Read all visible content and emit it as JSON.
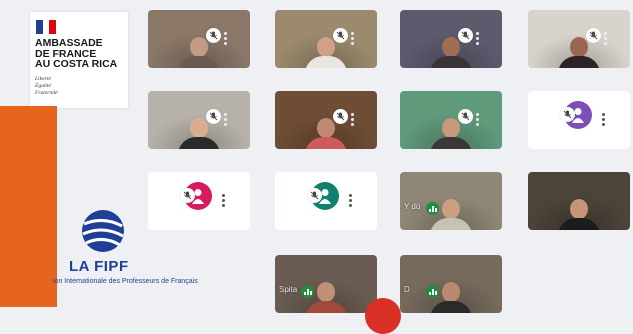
{
  "embassy": {
    "title": "AMBASSADE\nDE FRANCE\nAU COSTA RICA",
    "motto": "Liberté\nÉgalité\nFraternité",
    "flag_colors": [
      "#1f3f96",
      "#ffffff",
      "#e1000f"
    ]
  },
  "fipf": {
    "title": "LA FIPF",
    "subtitle": "ion Internationale des Professeurs de Français",
    "brand_color": "#1f3f96"
  },
  "colors": {
    "accent_orange": "#e6641e",
    "signal_green": "#1e8e3e"
  },
  "participants": [
    {
      "id": "p1",
      "type": "camera",
      "bg": "#8a7768",
      "muted": true,
      "skin": "#c49a82",
      "shirt": "#6a5a50"
    },
    {
      "id": "p2",
      "type": "camera",
      "bg": "#9b8a6d",
      "muted": true,
      "skin": "#d1a08a",
      "shirt": "#e9e6e1"
    },
    {
      "id": "p3",
      "type": "camera",
      "bg": "#5d5a6e",
      "muted": true,
      "skin": "#a06e55",
      "shirt": "#3a3434"
    },
    {
      "id": "p4",
      "type": "camera",
      "bg": "#d9d3cd",
      "muted": true,
      "skin": "#9a6650",
      "shirt": "#2c2424"
    },
    {
      "id": "p5",
      "type": "camera",
      "bg": "#b7b2a9",
      "muted": true,
      "skin": "#d8ad92",
      "shirt": "#2a2a2a"
    },
    {
      "id": "p6",
      "type": "camera",
      "bg": "#6e4d36",
      "muted": true,
      "skin": "#c08a72",
      "shirt": "#cf5a5a"
    },
    {
      "id": "p7",
      "type": "camera",
      "bg": "#5f9a7b",
      "muted": true,
      "skin": "#c9977a",
      "shirt": "#3d3636"
    },
    {
      "id": "p8",
      "type": "avatar",
      "avatar_color": "#7b4fb5",
      "muted": true
    },
    {
      "id": "p9",
      "type": "avatar",
      "avatar_color": "#d81b60",
      "muted": true
    },
    {
      "id": "p10",
      "type": "avatar",
      "avatar_color": "#12806e",
      "muted": true
    },
    {
      "id": "p11",
      "type": "camera",
      "bg": "#8f8776",
      "skin": "#caa07f",
      "shirt": "#c7c2b5",
      "speaking": true,
      "label": "Y                               dú"
    },
    {
      "id": "p12",
      "type": "camera",
      "bg": "#4c4339",
      "skin": "#c69578",
      "shirt": "#1c1c1c"
    },
    {
      "id": "p13",
      "type": "camera",
      "bg": "#6a5c52",
      "skin": "#c19078",
      "shirt": "#a14a3a",
      "speaking": true,
      "label": "    Spita"
    },
    {
      "id": "p14",
      "type": "camera",
      "bg": "#766a5c",
      "skin": "#b98a6f",
      "shirt": "#2a2a2a",
      "speaking": true,
      "label": "D"
    }
  ]
}
